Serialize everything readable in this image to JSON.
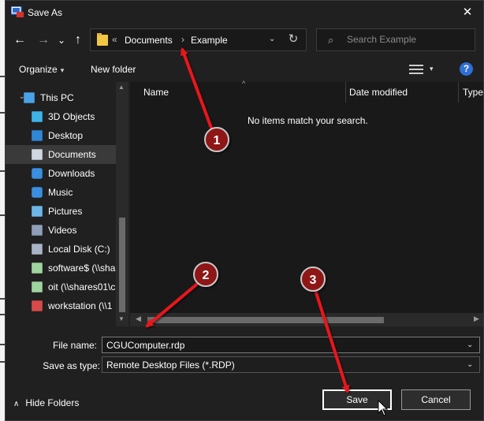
{
  "window": {
    "title": "Save As",
    "close_glyph": "✕"
  },
  "nav": {
    "back_glyph": "←",
    "forward_glyph": "→",
    "recent_glyph": "⌄",
    "up_glyph": "↑",
    "address": {
      "overflow": "«",
      "crumbs": [
        "Documents",
        "Example"
      ],
      "separator": "›"
    },
    "refresh_glyph": "↻",
    "search_placeholder": "Search Example"
  },
  "toolbar": {
    "organize": "Organize",
    "caret": "▾",
    "new_folder": "New folder",
    "help": "?"
  },
  "tree": {
    "items": [
      {
        "label": "This PC",
        "icon": "computer-icon",
        "level": 0
      },
      {
        "label": "3D Objects",
        "icon": "cube-icon",
        "level": 1
      },
      {
        "label": "Desktop",
        "icon": "desktop-icon",
        "level": 1
      },
      {
        "label": "Documents",
        "icon": "document-icon",
        "level": 1,
        "selected": true
      },
      {
        "label": "Downloads",
        "icon": "download-icon",
        "level": 1
      },
      {
        "label": "Music",
        "icon": "music-icon",
        "level": 1
      },
      {
        "label": "Pictures",
        "icon": "picture-icon",
        "level": 1
      },
      {
        "label": "Videos",
        "icon": "video-icon",
        "level": 1
      },
      {
        "label": "Local Disk (C:)",
        "icon": "disk-icon",
        "level": 1
      },
      {
        "label": "software$ (\\\\shar",
        "icon": "network-drive-icon",
        "level": 1
      },
      {
        "label": "oit (\\\\shares01\\c",
        "icon": "network-drive-icon",
        "level": 1
      },
      {
        "label": "workstation (\\\\1",
        "icon": "disconnected-drive-icon",
        "level": 1
      }
    ]
  },
  "columns": {
    "name": "Name",
    "date_modified": "Date modified",
    "type": "Type"
  },
  "empty_message": "No items match your search.",
  "form": {
    "file_name_label": "File name:",
    "file_name_value": "CGUComputer.rdp",
    "save_type_label": "Save as type:",
    "save_type_value": "Remote Desktop Files (*.RDP)"
  },
  "footer": {
    "hide_folders": "Hide Folders",
    "save": "Save",
    "cancel": "Cancel"
  },
  "annotations": [
    {
      "number": "1"
    },
    {
      "number": "2"
    },
    {
      "number": "3"
    }
  ],
  "colors": {
    "dialog_bg": "#202020",
    "content_bg": "#191919",
    "arrow_red": "#e8171c",
    "badge_red": "#8e1517",
    "help_blue": "#2f6fd6"
  }
}
